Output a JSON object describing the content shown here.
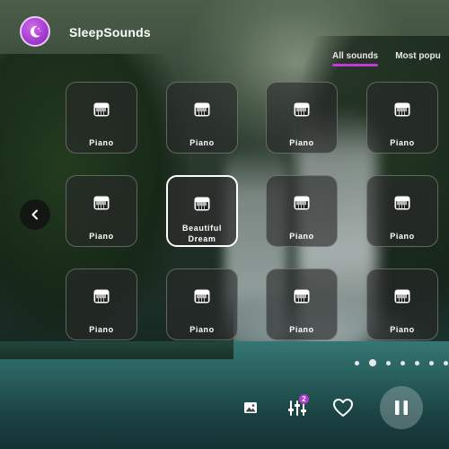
{
  "app": {
    "name": "SleepSounds"
  },
  "tabs": [
    {
      "label": "All sounds",
      "active": true
    },
    {
      "label": "Most popu",
      "active": false
    }
  ],
  "tiles": [
    {
      "label": "Piano",
      "icon": "piano-icon",
      "selected": false
    },
    {
      "label": "Piano",
      "icon": "piano-icon",
      "selected": false
    },
    {
      "label": "Piano",
      "icon": "piano-icon",
      "selected": false
    },
    {
      "label": "Piano",
      "icon": "piano-icon",
      "selected": false
    },
    {
      "label": "Piano",
      "icon": "piano-icon",
      "selected": false
    },
    {
      "label_line1": "Beautiful",
      "label_line2": "Dream",
      "icon": "piano-icon",
      "selected": true
    },
    {
      "label": "Piano",
      "icon": "piano-icon",
      "selected": false
    },
    {
      "label": "Piano",
      "icon": "piano-icon",
      "selected": false
    },
    {
      "label": "Piano",
      "icon": "piano-icon",
      "selected": false
    },
    {
      "label": "Piano",
      "icon": "piano-icon",
      "selected": false
    },
    {
      "label": "Piano",
      "icon": "piano-icon",
      "selected": false
    },
    {
      "label": "Piano",
      "icon": "piano-icon",
      "selected": false
    }
  ],
  "pagination": {
    "page_count": 8,
    "current_page": 2
  },
  "controls": {
    "mixer_badge": "2",
    "icons": [
      "image-icon",
      "mixer-icon",
      "heart-icon",
      "pause-icon",
      "moon-icon",
      "chevron-left-icon"
    ]
  },
  "colors": {
    "accent": "#c23ad6",
    "logo": "#a23bd0"
  }
}
